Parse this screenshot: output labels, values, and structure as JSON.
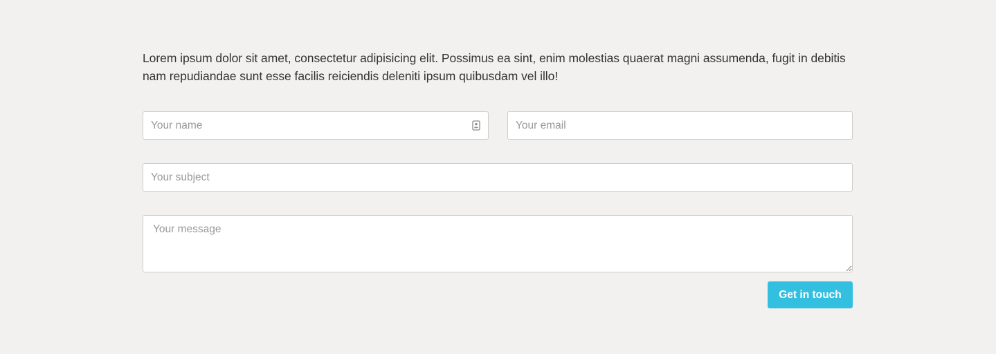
{
  "intro": {
    "text": "Lorem ipsum dolor sit amet, consectetur adipisicing elit. Possimus ea sint, enim molestias quaerat magni assumenda, fugit in debitis nam repudiandae sunt esse facilis reiciendis deleniti ipsum quibusdam vel illo!"
  },
  "form": {
    "name": {
      "value": "",
      "placeholder": "Your name",
      "icon": "contact-card-icon"
    },
    "email": {
      "value": "",
      "placeholder": "Your email"
    },
    "subject": {
      "value": "",
      "placeholder": "Your subject"
    },
    "message": {
      "value": "",
      "placeholder": "Your message"
    },
    "submit_label": "Get in touch"
  },
  "colors": {
    "background": "#f2f1ef",
    "text": "#333333",
    "placeholder": "#999999",
    "field_border": "#cccccc",
    "button": "#33c0e0",
    "button_text": "#ffffff"
  }
}
